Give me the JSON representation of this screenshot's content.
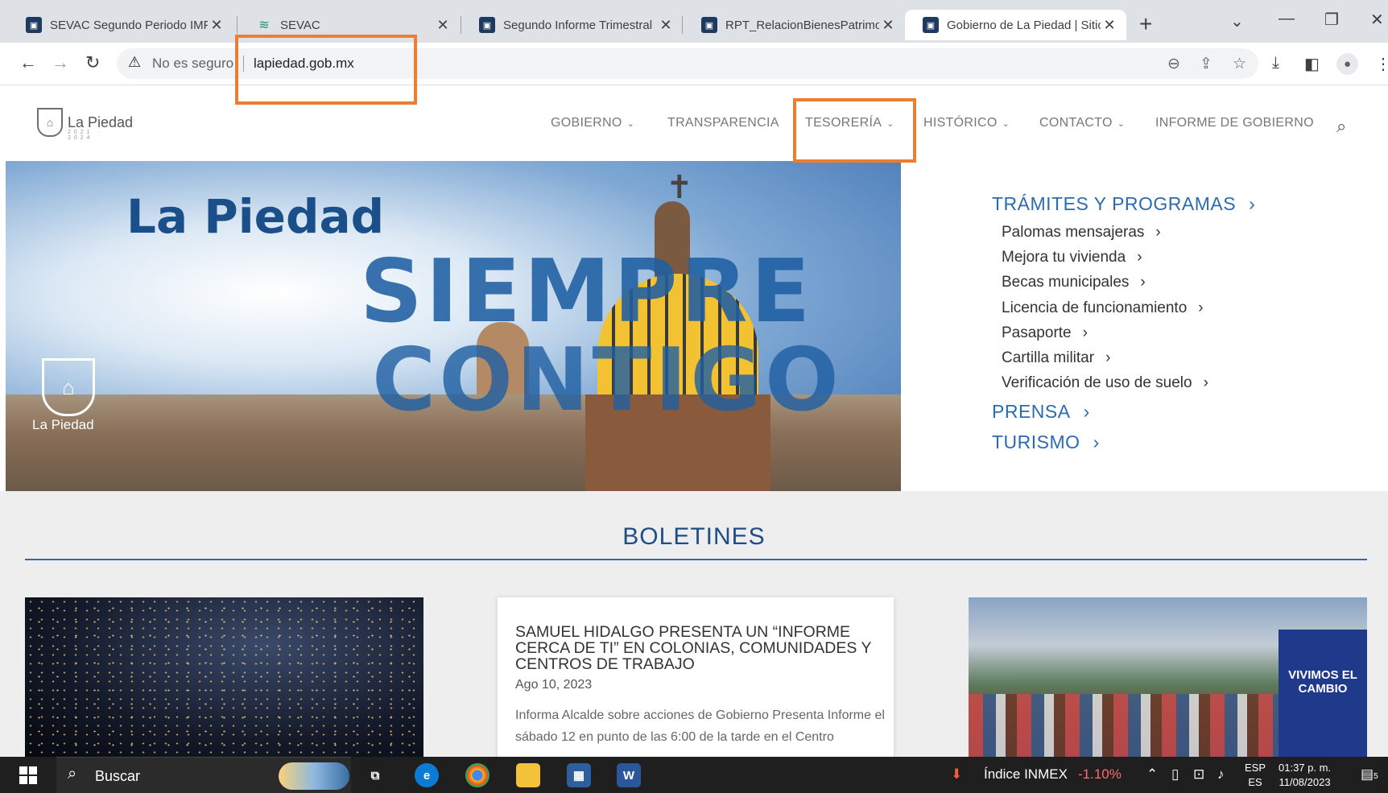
{
  "browser": {
    "tabs": [
      {
        "title": "SEVAC Segundo Periodo IMP",
        "favicon": "government-seal-icon"
      },
      {
        "title": "SEVAC",
        "favicon": "sevac-logo-icon"
      },
      {
        "title": "Segundo Informe Trimestral",
        "favicon": "government-seal-icon"
      },
      {
        "title": "RPT_RelacionBienesPatrimon",
        "favicon": "government-seal-icon"
      },
      {
        "title": "Gobierno de La Piedad | Sitio",
        "favicon": "government-seal-icon",
        "active": true
      }
    ],
    "address": {
      "security_label": "No es seguro",
      "url": "lapiedad.gob.mx"
    },
    "highlight_color": "#ed7d31"
  },
  "site": {
    "logo_text": "La Piedad",
    "logo_years": "2021 · 2024",
    "nav": [
      {
        "label": "GOBIERNO",
        "has_dropdown": true
      },
      {
        "label": "TRANSPARENCIA",
        "has_dropdown": false
      },
      {
        "label": "TESORERÍA",
        "has_dropdown": true
      },
      {
        "label": "HISTÓRICO",
        "has_dropdown": true
      },
      {
        "label": "CONTACTO",
        "has_dropdown": true
      },
      {
        "label": "INFORME DE GOBIERNO",
        "has_dropdown": false
      }
    ],
    "hero": {
      "title": "La Piedad",
      "slogan_line1": "SIEMPRE",
      "slogan_line2": "CONTIGO",
      "badge_text": "La Piedad"
    },
    "quick_links": {
      "tramites_heading": "TRÁMITES Y PROGRAMAS",
      "tramites": [
        "Palomas mensajeras",
        "Mejora tu vivienda",
        "Becas municipales",
        "Licencia de funcionamiento",
        "Pasaporte",
        "Cartilla militar",
        "Verificación de uso de suelo"
      ],
      "prensa": "PRENSA",
      "turismo": "TURISMO"
    },
    "boletines": {
      "title": "BOLETINES",
      "featured": {
        "headline": "SAMUEL HIDALGO PRESENTA UN “INFORME CERCA DE TI” EN COLONIAS, COMUNIDADES Y CENTROS DE TRABAJO",
        "date": "Ago 10, 2023",
        "excerpt": "Informa Alcalde sobre acciones de Gobierno Presenta Informe el sábado 12 en punto de las 6:00 de la tarde en el Centro"
      },
      "banner_text": "VIVIMOS EL CAMBIO"
    },
    "accent_color": "#2b6cb0"
  },
  "taskbar": {
    "search_label": "Buscar",
    "stock_name": "Índice INMEX",
    "stock_change": "-1.10%",
    "lang_top": "ESP",
    "lang_bottom": "ES",
    "time": "01:37 p. m.",
    "date": "11/08/2023",
    "notification_count": "5"
  }
}
